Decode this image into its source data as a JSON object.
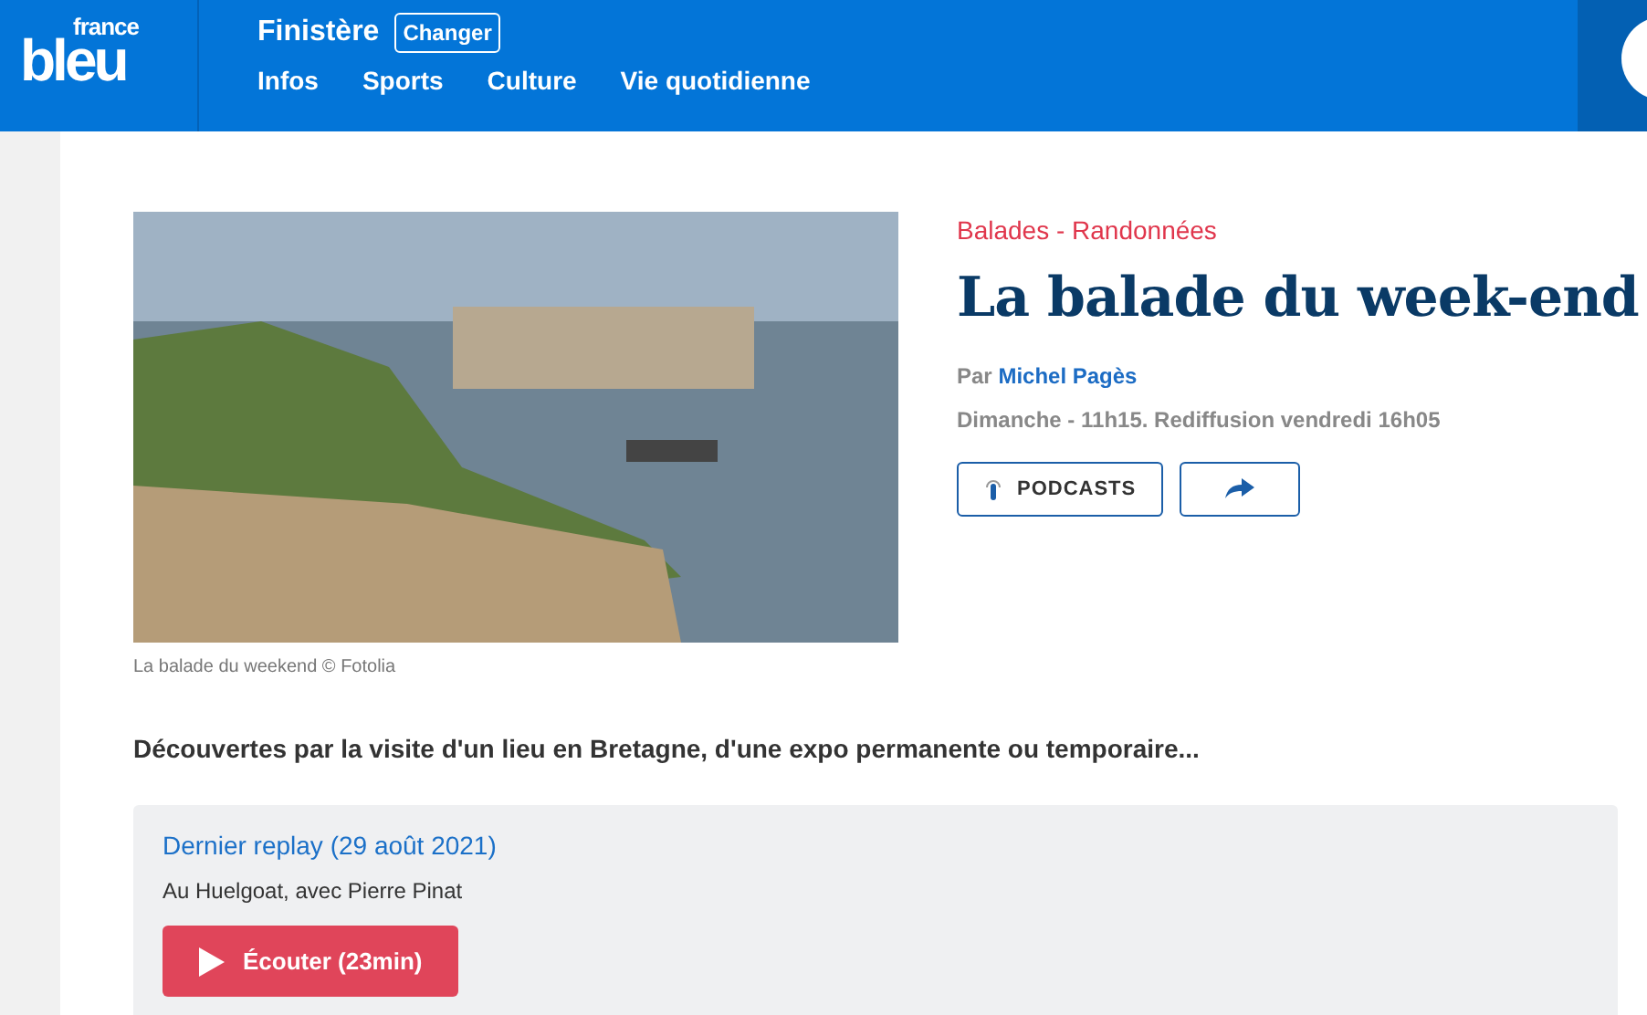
{
  "header": {
    "logo": {
      "top": "france",
      "main": "bleu"
    },
    "region": "Finistère",
    "change_button": "Changer",
    "nav": [
      "Infos",
      "Sports",
      "Culture",
      "Vie quotidienne"
    ]
  },
  "show": {
    "image_caption": "La balade du weekend © Fotolia",
    "category": "Balades - Randonnées",
    "title": "La balade du week-end",
    "author_prefix": "Par",
    "author": "Michel Pagès",
    "schedule": "Dimanche - 11h15. Rediffusion vendredi 16h05",
    "podcasts_button": "PODCASTS",
    "description": "Découvertes par la visite d'un lieu en Bretagne, d'une expo permanente ou temporaire...",
    "replay": {
      "title": "Dernier replay (29 août 2021)",
      "subtitle": "Au Huelgoat, avec Pierre Pinat",
      "listen_button": "Écouter (23min)"
    }
  }
}
